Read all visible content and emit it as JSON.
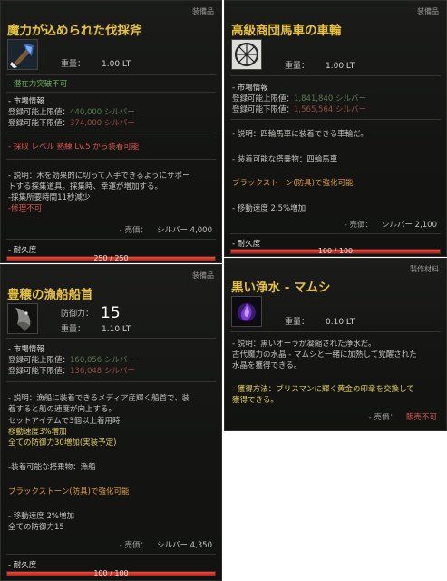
{
  "axe": {
    "category": "装備品",
    "title": "魔力が込められた伐採斧",
    "weight_label": "重量：",
    "weight": "1.00 LT",
    "potential": "- 潜在力突破不可",
    "market_header": "- 市場情報",
    "max_price_label": "登録可能上限値：",
    "max_price": "440,000 シルバー",
    "min_price_label": "登録可能下限値：",
    "min_price": "374,000 シルバー",
    "requirement": "- 採取 レベル 熟練 Lv.5 から装着可能",
    "desc_1": "- 説明：木を効果的に切って入手できるようにサポー",
    "desc_2": "トする採集道具。採集時、幸運が増加する。",
    "desc_3": "-採集所要時間11秒減少",
    "desc_4": "-修理不可",
    "price_label": "- 売価：",
    "price": "シルバー 4,000",
    "durability_label": "- 耐久度",
    "durability": "250 / 250",
    "durability_ratio": 1.0
  },
  "wheel": {
    "category": "装備品",
    "title": "高級商団馬車の車輪",
    "weight_label": "重量：",
    "weight": "1.00 LT",
    "market_header": "- 市場情報",
    "max_price_label": "登録可能上限値：",
    "max_price": "1,841,840 シルバー",
    "min_price_label": "登録可能下限値：",
    "min_price": "1,565,564 シルバー",
    "desc": "- 説明：四輪馬車に装着できる車輪だ。",
    "mount_1": "- 装着可能な搭乗物：四輪馬車",
    "blackstone": "ブラックストーン(防具)で強化可能",
    "speed": "- 移動速度 2.5%増加",
    "price_label": "- 売価：",
    "price": "シルバー 2,100",
    "durability_label": "- 耐久度",
    "durability": "100 / 100",
    "durability_ratio": 1.0
  },
  "prow": {
    "category": "装備品",
    "title": "豊穣の漁船船首",
    "defense_label": "防御力：",
    "defense": "15",
    "weight_label": "重量：",
    "weight": "1.10 LT",
    "market_header": "- 市場情報",
    "max_price_label": "登録可能上限値：",
    "max_price": "160,056 シルバー",
    "min_price_label": "登録可能下限値：",
    "min_price": "136,048 シルバー",
    "desc_1": "- 説明：漁船に装着できるメディア産輝く船首で、装",
    "desc_2": "着すると船の速度が向上する。",
    "desc_3": "セットアイテムで3個以上着用時",
    "desc_4": "移動速度3%増加",
    "desc_5": "全ての防御力30増加(実装予定)",
    "mount": "-装着可能な搭乗物：漁船",
    "blackstone": "ブラックストーン(防具)で強化可能",
    "speed": "- 移動速度 2%増加",
    "defense_all": "全ての防御力15",
    "price_label": "- 売価：",
    "price": "シルバー 4,350",
    "durability_label": "- 耐久度",
    "durability": "100 / 100",
    "durability_ratio": 1.0
  },
  "water": {
    "category": "製作材料",
    "title": "黒い浄水 - マムシ",
    "weight_label": "重量：",
    "weight": "0.10 LT",
    "desc_1": "- 説明：黒いオーラが凝縮された浄水だ。",
    "desc_2": "古代魔力の水晶 - マムシと一緒に加熱して覚醒された",
    "desc_3": "水晶を獲得できる。",
    "acquire_1": "- 獲得方法：ブリスマンに輝く黄金の印章を交換して",
    "acquire_2": "獲得できる。",
    "price_label": "- 売価：",
    "price": "販売不可"
  },
  "colors": {
    "title": "#e8c33a",
    "green": "#6fae63",
    "red": "#d9574f",
    "durability": "#e0352a"
  },
  "icons": {
    "axe": "axe-icon",
    "wheel": "wheel-icon",
    "prow": "ship-prow-icon",
    "water": "purple-flask-icon"
  }
}
